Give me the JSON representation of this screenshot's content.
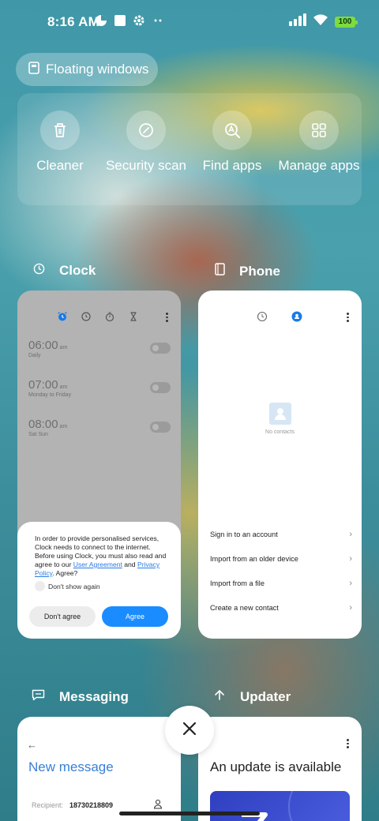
{
  "status_bar": {
    "time": "8:16 AM",
    "battery": "100",
    "icons": [
      "data-saver-icon",
      "square-icon",
      "gear-icon",
      "more-dots-icon",
      "signal-icon",
      "wifi-icon",
      "battery-icon"
    ]
  },
  "floating_windows": {
    "label": "Floating windows"
  },
  "tools": [
    {
      "label": "Cleaner",
      "icon": "trash-icon"
    },
    {
      "label": "Security scan",
      "icon": "shield-check-icon"
    },
    {
      "label": "Find apps",
      "icon": "find-apps-icon"
    },
    {
      "label": "Manage apps",
      "icon": "grid-icon"
    }
  ],
  "recent_apps": [
    {
      "name": "Clock",
      "icon": "clock-icon",
      "alarms": [
        {
          "time": "06:00",
          "suffix": "am",
          "repeat": "Daily"
        },
        {
          "time": "07:00",
          "suffix": "am",
          "repeat": "Monday to Friday"
        },
        {
          "time": "08:00",
          "suffix": "am",
          "repeat": "Sat Sun"
        }
      ],
      "dialog": {
        "text_before": "In order to provide personalised services, Clock needs to connect to the internet. Before using Clock, you must also read and agree to our",
        "link1": "User Agreement",
        "and": "and",
        "link2": "Privacy Policy",
        "text_after": ". Agree?",
        "checkbox": "Don't show again",
        "decline": "Don't agree",
        "accept": "Agree"
      }
    },
    {
      "name": "Phone",
      "icon": "phone-book-icon",
      "empty_text": "No contacts",
      "options": [
        "Sign in to an account",
        "Import from an older device",
        "Import from a file",
        "Create a new contact"
      ]
    },
    {
      "name": "Messaging",
      "icon": "message-icon",
      "title": "New message",
      "recipient_label": "Recipient:",
      "recipient_value": "18730218809"
    },
    {
      "name": "Updater",
      "icon": "arrow-up-icon",
      "title": "An update is available"
    }
  ],
  "colors": {
    "accent": "#1a8cff",
    "link": "#2a7be4",
    "battery": "#7ddb3f"
  }
}
